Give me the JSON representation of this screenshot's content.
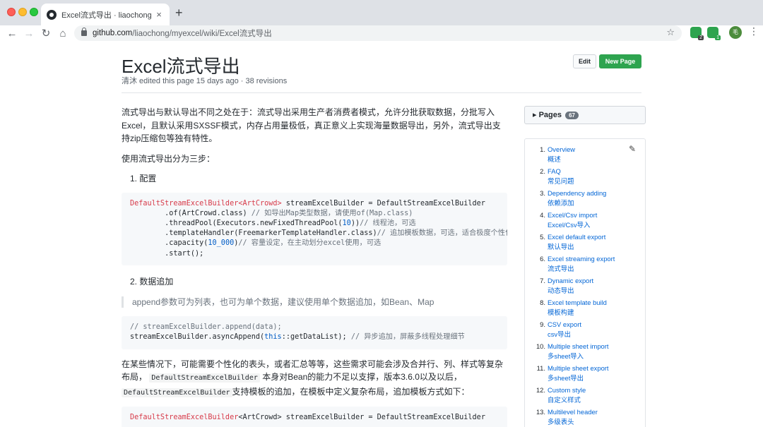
{
  "browser": {
    "tab_title": "Excel流式导出 · liaochong/myexcel",
    "tab_close": "×",
    "new_tab": "+",
    "url_host": "github.com",
    "url_path": "/liaochong/myexcel/wiki/Excel流式导出",
    "ext_badges": [
      "2",
      "1"
    ],
    "avatar_text": "毛"
  },
  "page": {
    "title": "Excel流式导出",
    "meta": "清沐 edited this page 15 days ago · 38 revisions",
    "edit_label": "Edit",
    "new_page_label": "New Page"
  },
  "content": {
    "intro": "流式导出与默认导出不同之处在于：流式导出采用生产者消费者模式，允许分批获取数据，分批写入Excel，且默认采用SXSSF模式，内存占用量极低，真正意义上实现海量数据导出，另外，流式导出支持zip压缩包等独有特性。",
    "steps_intro": "使用流式导出分为三步：",
    "step1": "1. 配置",
    "step2": "2. 数据追加",
    "quote": "append参数可为列表，也可为单个数据，建议使用单个数据追加，如Bean、Map",
    "para3_a": "在某些情况下，可能需要个性化的表头，或者汇总等等，这些需求可能会涉及合并行、列、样式等复杂布局，",
    "para3_code1": "DefaultStreamExcelBuilder",
    "para3_b": "本身对Bean的能力不足以支撑，版本3.6.0以及以后，",
    "para3_code2": "DefaultStreamExcelBuilder",
    "para3_c": "支持模板的追加，在模板中定义复杂布局，追加模板方式如下：",
    "code1": {
      "l1_kw": "DefaultStreamExcelBuilder<ArtCrowd>",
      "l1_rest": " streamExcelBuilder = DefaultStreamExcelBuilder",
      "l2_code": "        .of(ArtCrowd.class) ",
      "l2_cm": "// 如导出Map类型数据，请使用of(Map.class)",
      "l3_code": "        .threadPool(Executors.newFixedThreadPool(",
      "l3_num": "10",
      "l3_end": "))",
      "l3_cm": "// 线程池，可选",
      "l4_code": "        .templateHandler(FreemarkerTemplateHandler.class)",
      "l4_cm": "// 追加模板数据，可选，适合极度个性化数据导出",
      "l5_code": "        .capacity(",
      "l5_num": "10_000",
      "l5_end": ")",
      "l5_cm": "// 容量设定，在主动划分excel使用，可选",
      "l6_code": "        .start();"
    },
    "code2": {
      "l1_cm": "// streamExcelBuilder.append(data);",
      "l2_a": "streamExcelBuilder.asyncAppend(",
      "l2_kw": "this",
      "l2_b": "::getDataList); ",
      "l2_cm": "// 异步追加，屏蔽多线程处理细节"
    },
    "code3": {
      "l1_kw": "DefaultStreamExcelBuilder",
      "l1_rest": "<ArtCrowd> streamExcelBuilder = DefaultStreamExcelBuilder"
    }
  },
  "sidebar": {
    "pages_label": "Pages",
    "pages_count": "67",
    "items": [
      {
        "num": "1.",
        "en": "Overview",
        "zh": "概述"
      },
      {
        "num": "2.",
        "en": "FAQ",
        "zh": "常见问题"
      },
      {
        "num": "3.",
        "en": "Dependency adding",
        "zh": "依赖添加"
      },
      {
        "num": "4.",
        "en": "Excel/Csv import",
        "zh": "Excel/Csv导入"
      },
      {
        "num": "5.",
        "en": "Excel default export",
        "zh": "默认导出"
      },
      {
        "num": "6.",
        "en": "Excel streaming export",
        "zh": "流式导出"
      },
      {
        "num": "7.",
        "en": "Dynamic export",
        "zh": "动态导出"
      },
      {
        "num": "8.",
        "en": "Excel template build",
        "zh": "模板构建"
      },
      {
        "num": "9.",
        "en": "CSV export",
        "zh": "csv导出"
      },
      {
        "num": "10.",
        "en": "Multiple sheet import",
        "zh": "多sheet导入"
      },
      {
        "num": "11.",
        "en": "Multiple sheet export",
        "zh": "多sheet导出"
      },
      {
        "num": "12.",
        "en": "Custom style",
        "zh": "自定义样式"
      },
      {
        "num": "13.",
        "en": "Multilevel header",
        "zh": "多级表头"
      }
    ]
  }
}
